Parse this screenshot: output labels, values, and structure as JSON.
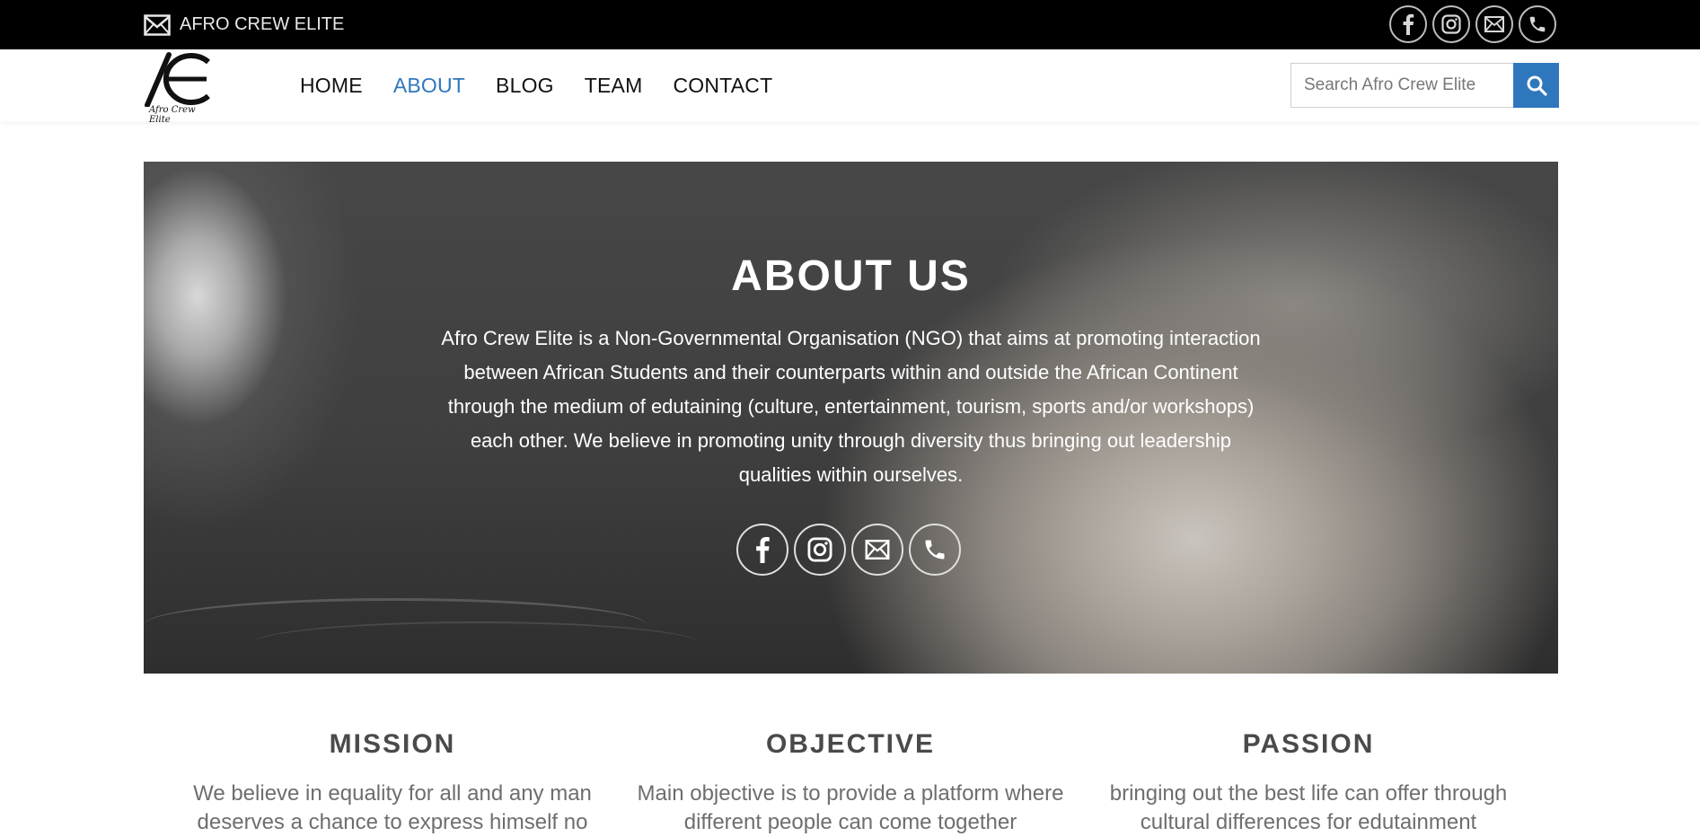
{
  "topbar": {
    "brand": "AFRO CREW ELITE",
    "socials": [
      "facebook-icon",
      "instagram-icon",
      "email-icon",
      "phone-icon"
    ]
  },
  "header": {
    "logo_tag": "Afro Crew Elite",
    "nav": [
      {
        "label": "HOME",
        "active": false
      },
      {
        "label": "ABOUT",
        "active": true
      },
      {
        "label": "BLOG",
        "active": false
      },
      {
        "label": "TEAM",
        "active": false
      },
      {
        "label": "CONTACT",
        "active": false
      }
    ],
    "search_placeholder": "Search Afro Crew Elite"
  },
  "hero": {
    "title": "ABOUT US",
    "text": "Afro Crew Elite is a Non-Governmental Organisation (NGO) that aims at promoting interaction between African Students and their counterparts within and outside the African Continent through the medium of  edutaining (culture, entertainment, tourism, sports and/or  workshops) each other. We believe in promoting unity through diversity thus bringing out leadership qualities within ourselves."
  },
  "features": [
    {
      "title": "MISSION",
      "text": "We believe in equality for all and any man deserves a chance to express himself no"
    },
    {
      "title": "OBJECTIVE",
      "text": "Main objective is to provide a platform where different people can come together"
    },
    {
      "title": "PASSION",
      "text": "bringing out the best life can offer through cultural differences for edutainment"
    }
  ],
  "colors": {
    "accent": "#2f77bd",
    "topbar": "#000000"
  }
}
